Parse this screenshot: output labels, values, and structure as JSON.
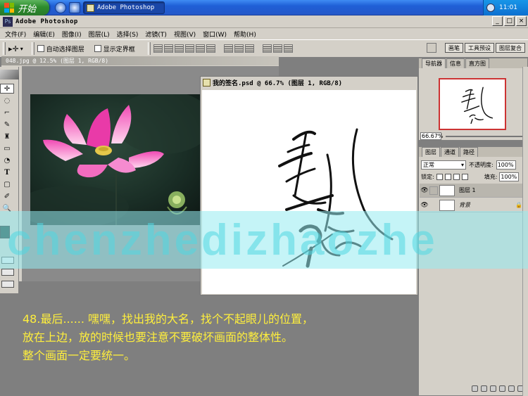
{
  "taskbar": {
    "start_label": "开始",
    "task_label": "Adobe Photoshop",
    "clock": "11:01"
  },
  "app": {
    "title": "Adobe Photoshop",
    "window_buttons": {
      "minimize": "_",
      "maximize": "□",
      "close": "×"
    }
  },
  "menu": [
    "文件(F)",
    "编辑(E)",
    "图像(I)",
    "图层(L)",
    "选择(S)",
    "滤镜(T)",
    "视图(V)",
    "窗口(W)",
    "帮助(H)"
  ],
  "options": {
    "tool_glyph": "▸✛",
    "auto_select_label": "自动选择图层",
    "show_bounds_label": "显示定界框",
    "palette_tabs": [
      "画笔",
      "工具预设",
      "图层复合"
    ]
  },
  "documents": {
    "photo_title": "048.jpg @ 12.5% (图层 1, RGB/8)",
    "signature_title": "我的签名.psd @ 66.7% (图层 1, RGB/8)"
  },
  "navigator": {
    "tabs": [
      "导航器",
      "信息",
      "直方图"
    ],
    "zoom": "66.67%"
  },
  "layers": {
    "tabs": [
      "图层",
      "通道",
      "路径"
    ],
    "blend_mode": "正常",
    "opacity_label": "不透明度:",
    "opacity_value": "100%",
    "lock_label": "锁定:",
    "fill_label": "填充:",
    "fill_value": "100%",
    "items": [
      {
        "name": "图层 1"
      },
      {
        "name": "背景",
        "lock": "🔒"
      }
    ]
  },
  "watermark": {
    "text": "chenzhedizhaozhe"
  },
  "caption": {
    "lines": [
      "48.最后...... 嘿嘿，找出我的大名，找个不起眼儿的位置，",
      "放在上边，放的时候也要注意不要破坏画面的整体性。",
      "整个画面一定要统一。"
    ]
  },
  "colors": {
    "caption": "#ffef3c",
    "watermark": "#96ebf0",
    "foreground_swatch": "#0e3a32",
    "background_swatch": "#f4f4f4"
  },
  "icons": [
    "windows-flag-icon",
    "ie-icon",
    "desktop-icon",
    "photoshop-icon",
    "move-tool-icon",
    "eye-icon",
    "brush-icon",
    "lock-icon"
  ]
}
